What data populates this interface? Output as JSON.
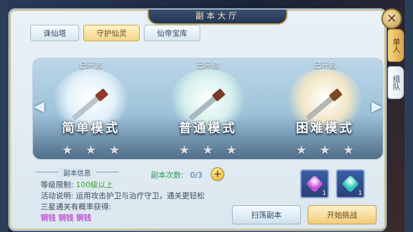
{
  "window": {
    "title": "副本大厅",
    "close_glyph": "✕"
  },
  "tabs": [
    {
      "label": "诛仙塔",
      "active": false
    },
    {
      "label": "守护仙灵",
      "active": true
    },
    {
      "label": "仙帝宝库",
      "active": false
    }
  ],
  "side_tabs": [
    {
      "label": "单人",
      "active": true
    },
    {
      "label": "组队",
      "active": false
    }
  ],
  "modes": [
    {
      "status": "已开启",
      "name": "简单模式",
      "stars": 3,
      "orb_color": "#e3f1fa",
      "blade_color": "#b9c4cc",
      "hilt_color": "#8c3b2b"
    },
    {
      "status": "已开启",
      "name": "普通模式",
      "stars": 3,
      "orb_color": "#d7f1ec",
      "blade_color": "#aab8c2",
      "hilt_color": "#7a3a2a"
    },
    {
      "status": "已开启",
      "name": "困难模式",
      "stars": 3,
      "orb_color": "#f1e6c7",
      "blade_color": "#b2b8b0",
      "hilt_color": "#7a4a22"
    }
  ],
  "nav": {
    "left_arrow": "◀",
    "right_arrow": "▶"
  },
  "info": {
    "header": "副本信息",
    "level_label": "等级限制:",
    "level_value": "100级以上",
    "desc_label": "活动说明:",
    "desc_value": "运用攻击护卫与治疗守卫，通关更轻松",
    "three_star_label": "三星通关有概率获得:",
    "three_star_rewards": "铜钱 铜钱 铜钱"
  },
  "count": {
    "label": "副本次数:",
    "value": "0/3",
    "plus_glyph": "+"
  },
  "rewards": [
    {
      "icon": "purple-gem-icon",
      "color": "#c84ed6",
      "qty": "1"
    },
    {
      "icon": "teal-gem-icon",
      "color": "#2cc7b6",
      "qty": "1"
    }
  ],
  "buttons": {
    "sweep": "扫荡副本",
    "start": "开始挑战"
  },
  "colors": {
    "accent_gold": "#d7a549",
    "panel_bg": "#dbe7ef",
    "green_text": "#39a52e",
    "reward_purple": "#c257cf"
  }
}
